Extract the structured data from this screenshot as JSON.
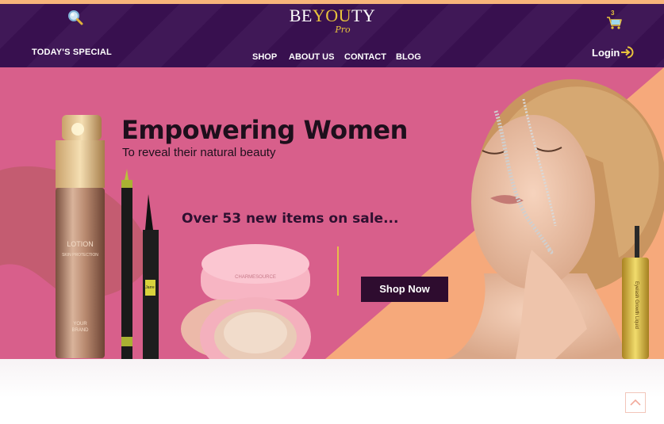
{
  "header": {
    "logo_main_left": "BE",
    "logo_main_mid": "YOU",
    "logo_main_right": "TY",
    "logo_sub": "Pro",
    "todays_special": "TODAY'S SPECIAL",
    "nav": [
      {
        "label": "SHOP"
      },
      {
        "label": "ABOUT US"
      },
      {
        "label": "CONTACT"
      },
      {
        "label": "BLOG"
      }
    ],
    "login_label": "Login",
    "cart_count": "3"
  },
  "hero": {
    "headline": "Empowering Women",
    "subline": "To reveal their natural beauty",
    "promo": "Over 53 new items on sale...",
    "cta": "Shop Now",
    "products": {
      "lotion_line1": "LOTION",
      "lotion_line2": "SKIN PROTECTION",
      "lotion_brand_1": "YOUR",
      "lotion_brand_2": "BRAND",
      "compact_text": "CHARMESOURCE",
      "eyeliner_label": "Jarre",
      "gloss_label": "Eyelash Growth Liquid"
    }
  },
  "colors": {
    "header_bg": "#3a1152",
    "accent_gold": "#e9c33c",
    "hero_pink": "#d85f8b",
    "hero_peach": "#f6a97b",
    "cta_bg": "#2e0c2f"
  },
  "icons": [
    "search-icon",
    "cart-icon",
    "login-arrow-icon",
    "chevron-down-icon",
    "arrow-up-icon"
  ]
}
